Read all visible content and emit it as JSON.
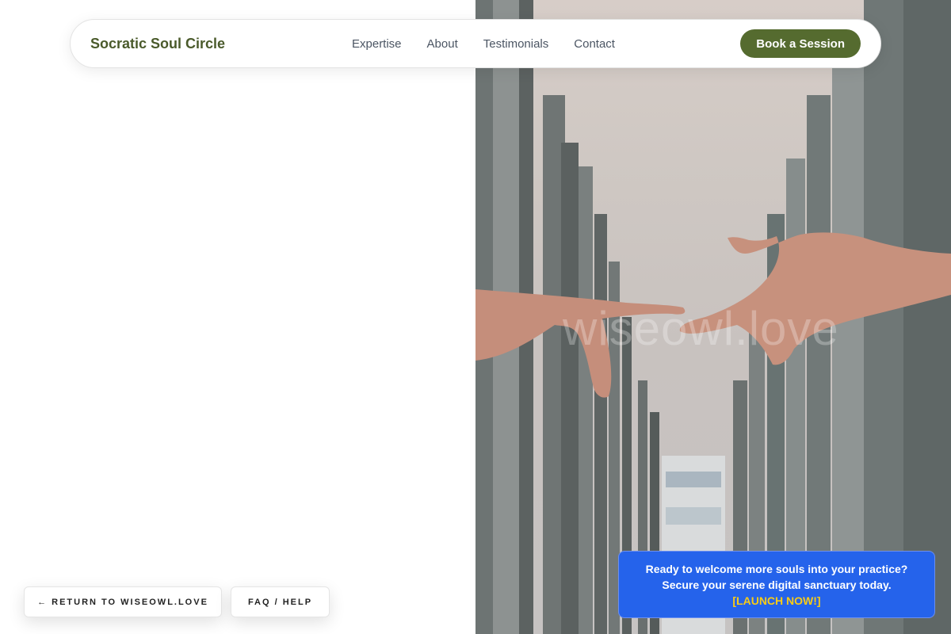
{
  "nav": {
    "brand": "Socratic Soul Circle",
    "links": [
      "Expertise",
      "About",
      "Testimonials",
      "Contact"
    ],
    "cta": "Book a Session"
  },
  "hero": {
    "watermark": "wiseowl.love"
  },
  "footer_buttons": {
    "return": "← RETURN TO WISEOWL.LOVE",
    "faq": "FAQ / HELP"
  },
  "promo": {
    "line1": "Ready to welcome more souls into your practice?",
    "line2": "Secure your serene digital sanctuary today.",
    "cta": "[LAUNCH NOW!]"
  },
  "colors": {
    "brand": "#4a5a2b",
    "button": "#556b2f",
    "promo_bg": "#2563eb",
    "promo_cta": "#facc15"
  }
}
